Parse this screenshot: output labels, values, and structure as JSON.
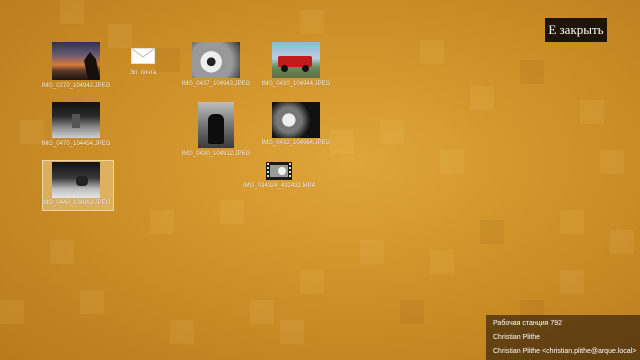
{
  "close_button": {
    "label": "Е закрыть"
  },
  "desktop": {
    "items": [
      {
        "label": "IMG_0270_104942.JPEG",
        "type": "photo"
      },
      {
        "label": "Эл. почта",
        "type": "mail-icon"
      },
      {
        "label": "IMG_0437_104943.JPEG",
        "type": "photo"
      },
      {
        "label": "IMG_0430_104944.JPEG",
        "type": "photo"
      },
      {
        "label": "IMG_0470_104454.JPEG",
        "type": "photo"
      },
      {
        "label": "IMG_0430_104912.JPEG",
        "type": "photo"
      },
      {
        "label": "IMG_0432_104964.JPEG",
        "type": "photo"
      },
      {
        "label": "IMG_034324_432432.MP4",
        "type": "video"
      },
      {
        "label": "IMG_0440_104963.JPEG",
        "type": "photo",
        "selected": true
      }
    ]
  },
  "user_panel": {
    "workstation": "Рабочая станция 792",
    "name": "Christian Plithe",
    "email": "Christian Plithe <christian.plithe@arque.local>"
  },
  "colors": {
    "background": "#cf9129",
    "close_button_bg": "#1f1409",
    "panel_bg": "#281908"
  }
}
